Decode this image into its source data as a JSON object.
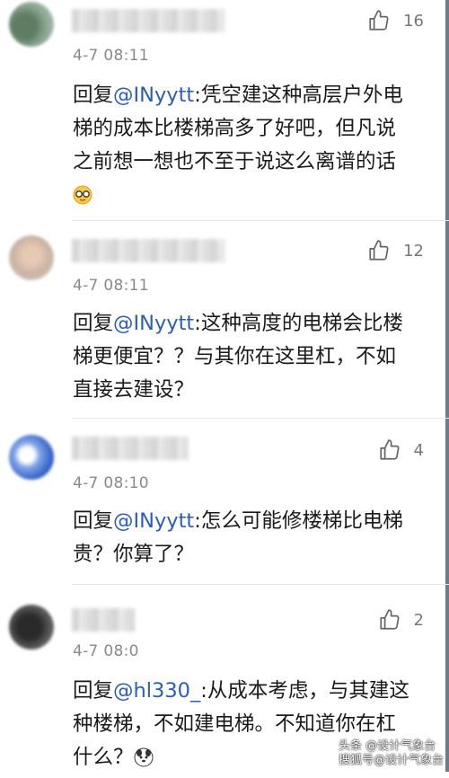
{
  "mention_prefix": "回复",
  "comments": [
    {
      "username": "",
      "timestamp": "4-7 08:11",
      "likes": "16",
      "mention": "@INyytt",
      "text": ":凭空建这种高层户外电梯的成本比楼梯高多了好吧，但凡说之前想一想也不至于说这么离谱的话",
      "emoji": "face-with-glasses"
    },
    {
      "username": "",
      "timestamp": "4-7 08:11",
      "likes": "12",
      "mention": "@INyytt",
      "text": ":这种高度的电梯会比楼梯更便宜？？与其你在这里杠，不如直接去建设？"
    },
    {
      "username": "",
      "timestamp": "4-7 08:10",
      "likes": "4",
      "mention": "@INyytt",
      "text": ":怎么可能修楼梯比电梯贵？你算了？"
    },
    {
      "username": "",
      "timestamp": "4-7 08:0",
      "likes": "2",
      "mention": "@hl330_",
      "text": ":从成本考虑，与其建这种楼梯，不如建电梯。不知道你在杠什么？",
      "emoji": "dog-face"
    }
  ],
  "watermark": {
    "line1": "头条 @设计气象台",
    "line2": "搜狐号@设计气象台"
  }
}
